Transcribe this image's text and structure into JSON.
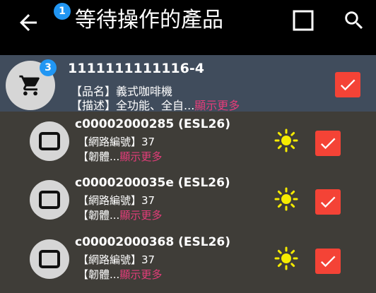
{
  "app_bar": {
    "title": "等待操作的產品",
    "notification_count": "1"
  },
  "product": {
    "badge_count": "3",
    "title": "1111111111116-4",
    "name_label": "【品名】",
    "name_value": "義式咖啡機",
    "desc_label": "【描述】",
    "desc_value": "全功能、全自...",
    "show_more": "顯示更多",
    "checked": true
  },
  "devices": [
    {
      "title": "c00002000285 (ESL26)",
      "net_label": "【網路編號】",
      "net_value": "37",
      "fw_label": "【韌體...",
      "show_more": "顯示更多",
      "checked": true
    },
    {
      "title": "c0000200035e (ESL26)",
      "net_label": "【網路編號】",
      "net_value": "37",
      "fw_label": "【韌體...",
      "show_more": "顯示更多",
      "checked": true
    },
    {
      "title": "c00002000368 (ESL26)",
      "net_label": "【網路編號】",
      "net_value": "37",
      "fw_label": "【韌體...",
      "show_more": "顯示更多",
      "checked": true
    }
  ],
  "icons": {
    "back": "arrow-back-icon",
    "select_all": "checkbox-outline-icon",
    "search": "search-icon",
    "product": "cart-icon",
    "device": "esl-tag-icon",
    "status": "sun-icon",
    "check": "check-icon"
  },
  "colors": {
    "app_bar": "#000000",
    "product_row": "#404c5c",
    "device_row": "#3f3d38",
    "badge": "#2196f3",
    "checkbox": "#f44336",
    "show_more": "#e53d7a",
    "sun": "#f5eb00"
  }
}
